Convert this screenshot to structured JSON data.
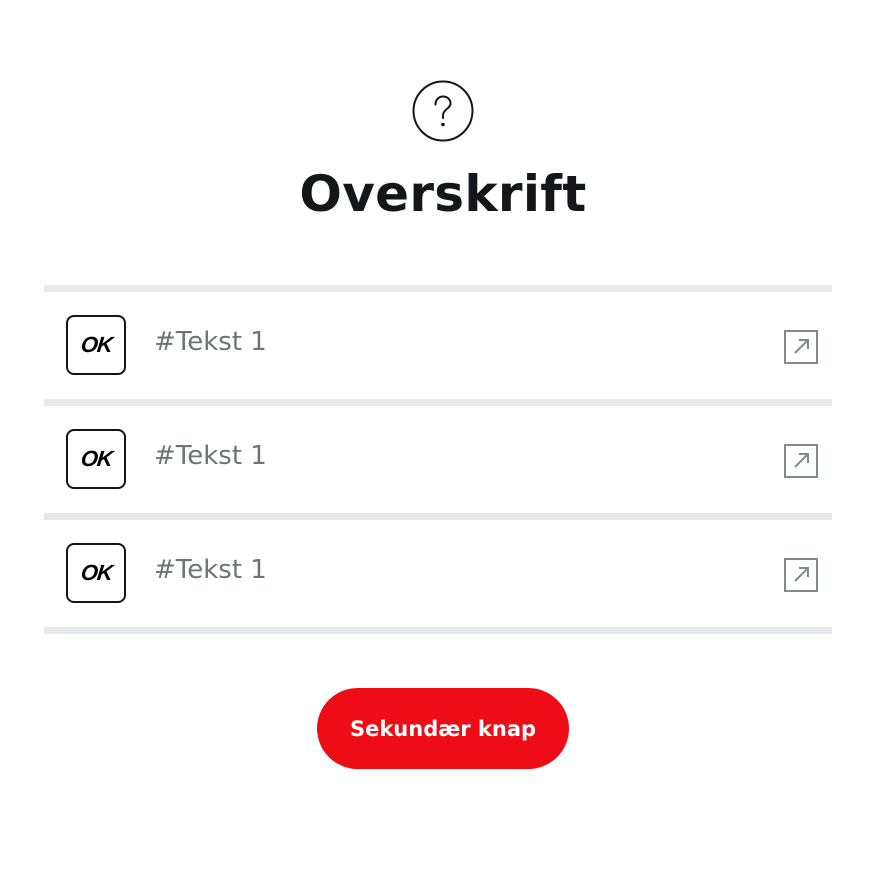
{
  "header": {
    "icon": "question-mark-circle-icon",
    "title": "Overskrift"
  },
  "list": {
    "items": [
      {
        "logo_text": "OK",
        "label": "#Tekst 1",
        "trailing_icon": "external-link-icon"
      },
      {
        "logo_text": "OK",
        "label": "#Tekst 1",
        "trailing_icon": "external-link-icon"
      },
      {
        "logo_text": "OK",
        "label": "#Tekst 1",
        "trailing_icon": "external-link-icon"
      }
    ]
  },
  "actions": {
    "secondary_button_label": "Sekundær knap"
  },
  "colors": {
    "accent": "#ee0d16",
    "divider": "#e7eaec",
    "text_primary": "#14171a",
    "text_muted": "#6a7672",
    "icon_muted": "#7f8c88"
  }
}
